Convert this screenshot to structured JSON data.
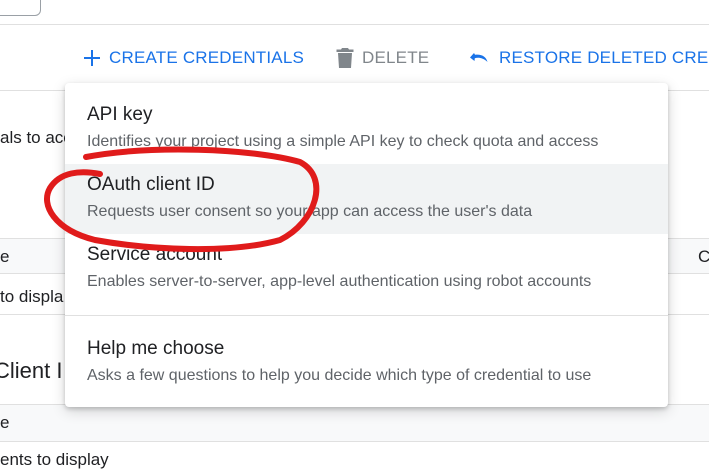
{
  "toolbar": {
    "create_label": "CREATE CREDENTIALS",
    "delete_label": "DELETE",
    "restore_label": "RESTORE DELETED CREDE"
  },
  "background": {
    "intro_fragment": "als to acc",
    "row1_col1": "e",
    "row1_col_right": "C",
    "row1_empty": "to displa",
    "section_title": "Client I",
    "row2_col1": "e",
    "row2_empty": "ents to display"
  },
  "menu": {
    "items": [
      {
        "title": "API key",
        "description": "Identifies your project using a simple API key to check quota and access"
      },
      {
        "title": "OAuth client ID",
        "description": "Requests user consent so your app can access the user's data"
      },
      {
        "title": "Service account",
        "description": "Enables server-to-server, app-level authentication using robot accounts"
      }
    ],
    "help": {
      "title": "Help me choose",
      "description": "Asks a few questions to help you decide which type of credential to use"
    }
  },
  "colors": {
    "primary": "#1a73e8",
    "disabled": "#80868b",
    "annotation": "#e01b1b",
    "hover": "#f1f3f4"
  }
}
